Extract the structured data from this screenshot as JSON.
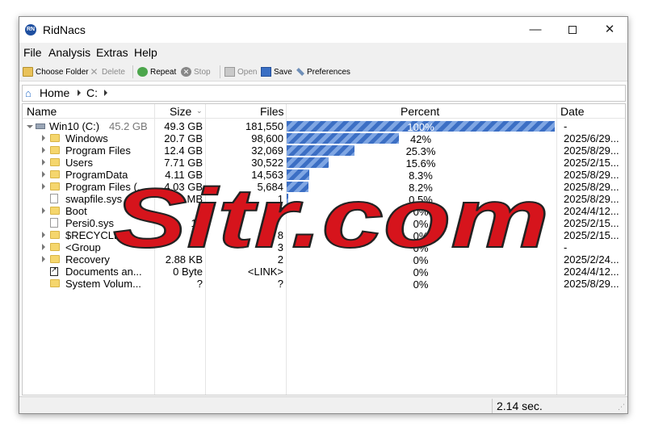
{
  "window": {
    "title": "RidNacs",
    "icon_text": "RN"
  },
  "window_controls": {
    "minimize": "—",
    "close": "✕"
  },
  "menu": [
    "File",
    "Analysis",
    "Extras",
    "Help"
  ],
  "toolbar": {
    "choose_folder": "Choose Folder",
    "delete": "Delete",
    "repeat": "Repeat",
    "stop": "Stop",
    "open": "Open",
    "save": "Save",
    "preferences": "Preferences"
  },
  "breadcrumb": {
    "home": "Home",
    "drive": "C:"
  },
  "columns": {
    "name": "Name",
    "size": "Size",
    "files": "Files",
    "percent": "Percent",
    "date": "Date"
  },
  "rows": [
    {
      "name": "Win10 (C:)",
      "drive_size": "45.2 GB",
      "size": "49.3 GB",
      "files": "181,550",
      "percent": "100%",
      "percent_value": 100,
      "date": "-",
      "icon": "drive-icon",
      "expander": "open"
    },
    {
      "name": "Windows",
      "size": "20.7 GB",
      "files": "98,600",
      "percent": "42%",
      "percent_value": 42,
      "date": "2025/6/29...",
      "icon": "folder-icon",
      "expander": "closed"
    },
    {
      "name": "Program Files",
      "size": "12.4 GB",
      "files": "32,069",
      "percent": "25.3%",
      "percent_value": 25.3,
      "date": "2025/8/29...",
      "icon": "folder-icon",
      "expander": "closed"
    },
    {
      "name": "Users",
      "size": "7.71 GB",
      "files": "30,522",
      "percent": "15.6%",
      "percent_value": 15.6,
      "date": "2025/2/15...",
      "icon": "folder-icon",
      "expander": "closed"
    },
    {
      "name": "ProgramData",
      "size": "4.11 GB",
      "files": "14,563",
      "percent": "8.3%",
      "percent_value": 8.3,
      "date": "2025/8/29...",
      "icon": "folder-icon",
      "expander": "closed"
    },
    {
      "name": "Program Files (...",
      "size": "4.03 GB",
      "files": "5,684",
      "percent": "8.2%",
      "percent_value": 8.2,
      "date": "2025/8/29...",
      "icon": "folder-icon",
      "expander": "closed"
    },
    {
      "name": "swapfile.sys",
      "size": "MB",
      "files": "1",
      "percent": "0.5%",
      "percent_value": 0.5,
      "date": "2025/8/29...",
      "icon": "file-icon",
      "expander": "none"
    },
    {
      "name": "Boot",
      "size": "0",
      "files": "87",
      "percent": "0%",
      "percent_value": 0,
      "date": "2024/4/12...",
      "icon": "folder-icon",
      "expander": "closed"
    },
    {
      "name": "Persi0.sys",
      "size": "16",
      "files": "",
      "percent": "0%",
      "percent_value": 0,
      "date": "2025/2/15...",
      "icon": "file-icon",
      "expander": "none"
    },
    {
      "name": "$RECYCLE",
      "size": "1",
      "files": "8",
      "percent": "0%",
      "percent_value": 0,
      "date": "2025/2/15...",
      "icon": "folder-icon",
      "expander": "closed"
    },
    {
      "name": "<Group",
      "size": "",
      "files": "3",
      "percent": "0%",
      "percent_value": 0,
      "date": "-",
      "icon": "folder-icon",
      "expander": "closed"
    },
    {
      "name": "Recovery",
      "size": "2.88 KB",
      "files": "2",
      "percent": "0%",
      "percent_value": 0,
      "date": "2025/2/24...",
      "icon": "folder-icon",
      "expander": "closed"
    },
    {
      "name": "Documents an...",
      "size": "0 Byte",
      "files": "<LINK>",
      "percent": "0%",
      "percent_value": 0,
      "date": "2024/4/12...",
      "icon": "link-icon",
      "expander": "none"
    },
    {
      "name": "System Volum...",
      "size": "?",
      "files": "?",
      "percent": "0%",
      "percent_value": 0,
      "date": "2025/8/29...",
      "icon": "folder-icon",
      "expander": "none"
    }
  ],
  "status": {
    "time": "2.14 sec."
  },
  "watermark": {
    "text": "Sitr.com"
  },
  "colors": {
    "bar": "#3c6fc4",
    "bar_light": "#7fa6e3",
    "watermark": "#d6141c"
  }
}
